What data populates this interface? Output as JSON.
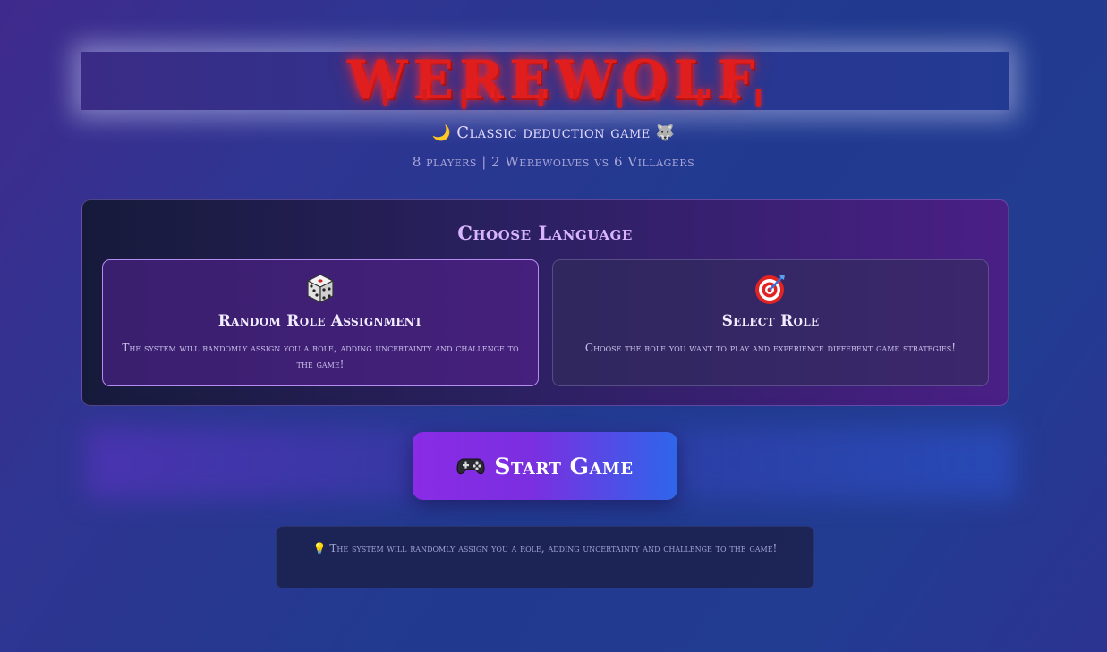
{
  "header": {
    "title": "WEREWOLF",
    "subtitle": "Classic deduction game",
    "subtitle_icon_left": "crescent-moon",
    "subtitle_icon_right": "wolf-face",
    "players_info": "8 players | 2 Werewolves vs 6 Villagers"
  },
  "choose": {
    "title": "Choose Language",
    "options": [
      {
        "icon": "dice",
        "title": "Random Role Assignment",
        "description": "The system will randomly assign you a role, adding uncertainty and challenge to the game!",
        "selected": true
      },
      {
        "icon": "target",
        "title": "Select Role",
        "description": "Choose the role you want to play and experience different game strategies!",
        "selected": false
      }
    ]
  },
  "start_button": {
    "icon": "gamepad",
    "label": "Start Game"
  },
  "hint": {
    "icon": "lightbulb",
    "text": "The system will randomly assign you a role, adding uncertainty and challenge to the game!"
  },
  "colors": {
    "title_red": "#e01e1e",
    "accent_purple": "#8a2be6",
    "accent_blue": "#2e66ea",
    "choose_title": "#d9b5ff"
  }
}
